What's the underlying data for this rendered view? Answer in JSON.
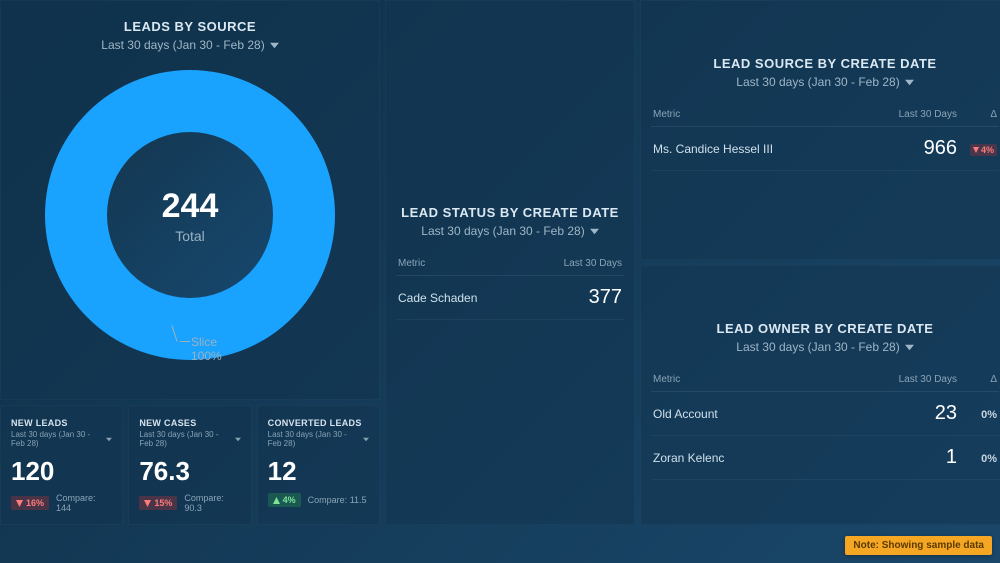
{
  "date_range_label": "Last 30 days (Jan 30 - Feb 28)",
  "chart_data": {
    "type": "pie",
    "title": "LEADS BY SOURCE",
    "total_label": "Total",
    "total_value": 244,
    "slices": [
      {
        "name": "Slice",
        "value": 244,
        "percent": 100
      }
    ],
    "colors": [
      "#1aa2ff"
    ],
    "legend_label": "Slice",
    "legend_percent": "100%"
  },
  "stat_cards": [
    {
      "title": "NEW LEADS",
      "range": "Last 30 days (Jan 30 - Feb 28)",
      "value": "120",
      "delta_dir": "down",
      "delta_text": "16%",
      "compare_label": "Compare:",
      "compare_value": "144"
    },
    {
      "title": "NEW CASES",
      "range": "Last 30 days (Jan 30 - Feb 28)",
      "value": "76.3",
      "delta_dir": "down",
      "delta_text": "15%",
      "compare_label": "Compare:",
      "compare_value": "90.3"
    },
    {
      "title": "CONVERTED LEADS",
      "range": "Last 30 days (Jan 30 - Feb 28)",
      "value": "12",
      "delta_dir": "up",
      "delta_text": "4%",
      "compare_label": "Compare:",
      "compare_value": "11.5"
    }
  ],
  "middle_panel": {
    "title": "LEAD STATUS BY CREATE DATE",
    "headers": {
      "c1": "Metric",
      "c2": "Last 30 Days"
    },
    "rows": [
      {
        "metric": "Cade Schaden",
        "value": "377"
      }
    ]
  },
  "top_right": {
    "title": "LEAD SOURCE BY CREATE DATE",
    "headers": {
      "c1": "Metric",
      "c2": "Last 30 Days",
      "c3": "Δ"
    },
    "rows": [
      {
        "metric": "Ms. Candice Hessel III",
        "value": "966",
        "delta_dir": "down",
        "delta_text": "4%"
      }
    ]
  },
  "bottom_right": {
    "title": "LEAD OWNER BY CREATE DATE",
    "headers": {
      "c1": "Metric",
      "c2": "Last 30 Days",
      "c3": "Δ"
    },
    "rows": [
      {
        "metric": "Old Account",
        "value": "23",
        "delta_text": "0%"
      },
      {
        "metric": "Zoran Kelenc",
        "value": "1",
        "delta_text": "0%"
      }
    ]
  },
  "note": "Note: Showing sample data"
}
